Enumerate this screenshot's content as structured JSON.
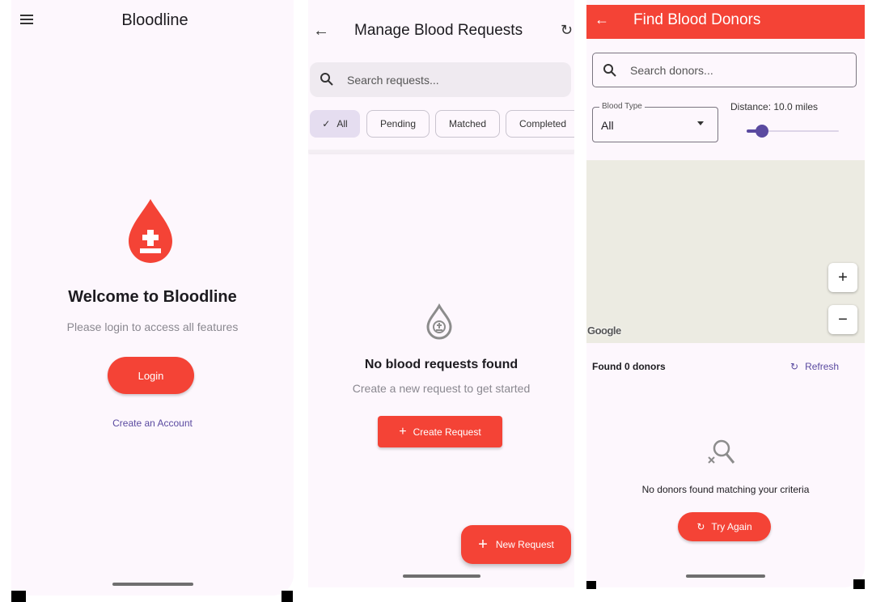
{
  "screen1": {
    "title": "Bloodline",
    "welcome": "Welcome to Bloodline",
    "subtitle": "Please login to access all features",
    "login_label": "Login",
    "create_account_label": "Create an Account",
    "icons": {
      "menu": "menu-icon",
      "logo": "blood-drop-icon"
    }
  },
  "screen2": {
    "title": "Manage Blood Requests",
    "search_placeholder": "Search requests...",
    "filters": [
      "All",
      "Pending",
      "Matched",
      "Completed"
    ],
    "selected_filter": "All",
    "empty_title": "No blood requests found",
    "empty_subtitle": "Create a new request to get started",
    "create_button": "Create Request",
    "fab_label": "New Request",
    "icons": {
      "back": "arrow-left-icon",
      "refresh": "refresh-icon",
      "search": "search-icon",
      "empty": "blood-drop-icon",
      "add": "plus-icon"
    }
  },
  "screen3": {
    "title": "Find Blood Donors",
    "search_placeholder": "Search donors...",
    "blood_type_label": "Blood Type",
    "blood_type_value": "All",
    "distance_label": "Distance: 10.0 miles",
    "distance_slider_fraction": 0.1,
    "map_attribution": "Google",
    "zoom_in": "+",
    "zoom_out": "−",
    "found_text": "Found 0 donors",
    "refresh_label": "Refresh",
    "empty_message": "No donors found matching your criteria",
    "try_again_label": "Try Again",
    "colors": {
      "accent": "#f44336",
      "primary": "#5a4aa0",
      "background": "#fdf7fd"
    },
    "icons": {
      "back": "arrow-left-icon",
      "search": "search-icon",
      "dropdown": "chevron-down-icon",
      "refresh": "refresh-icon",
      "empty": "search-off-icon"
    }
  }
}
